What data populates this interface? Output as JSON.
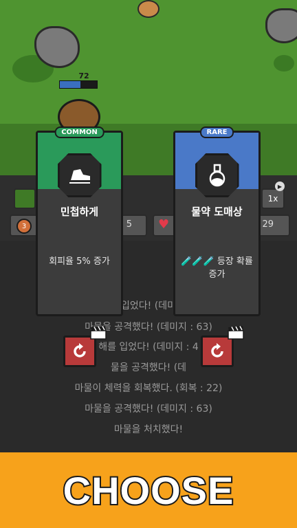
{
  "game": {
    "enemy_hp": "72",
    "speed": "1x",
    "left_stat_value": "5",
    "right_stat_value": "29",
    "coin_level": "3"
  },
  "log": [
    "입었다! (데미",
    "마물을 공격했다! (데미지 : 63)",
    "해를 입었다! (데미지 : 4",
    "물을 공격했다! (데",
    "마물이 체력을 회복했다. (회복 : 22)",
    "마물을 공격했다! (데미지 : 63)",
    "마물을 처치했다!"
  ],
  "cards": [
    {
      "rarity": "COMMON",
      "title": "민첩하게",
      "desc": "회피율 5% 증가",
      "icon": "shoe-icon",
      "color": "#2a9a5a"
    },
    {
      "rarity": "RARE",
      "title": "물약 도매상",
      "desc": "🧪🧪🧪 등장 확률 증가",
      "icon": "potion-icon",
      "color": "#4a79c8"
    }
  ],
  "banner": {
    "text": "CHOOSE"
  }
}
